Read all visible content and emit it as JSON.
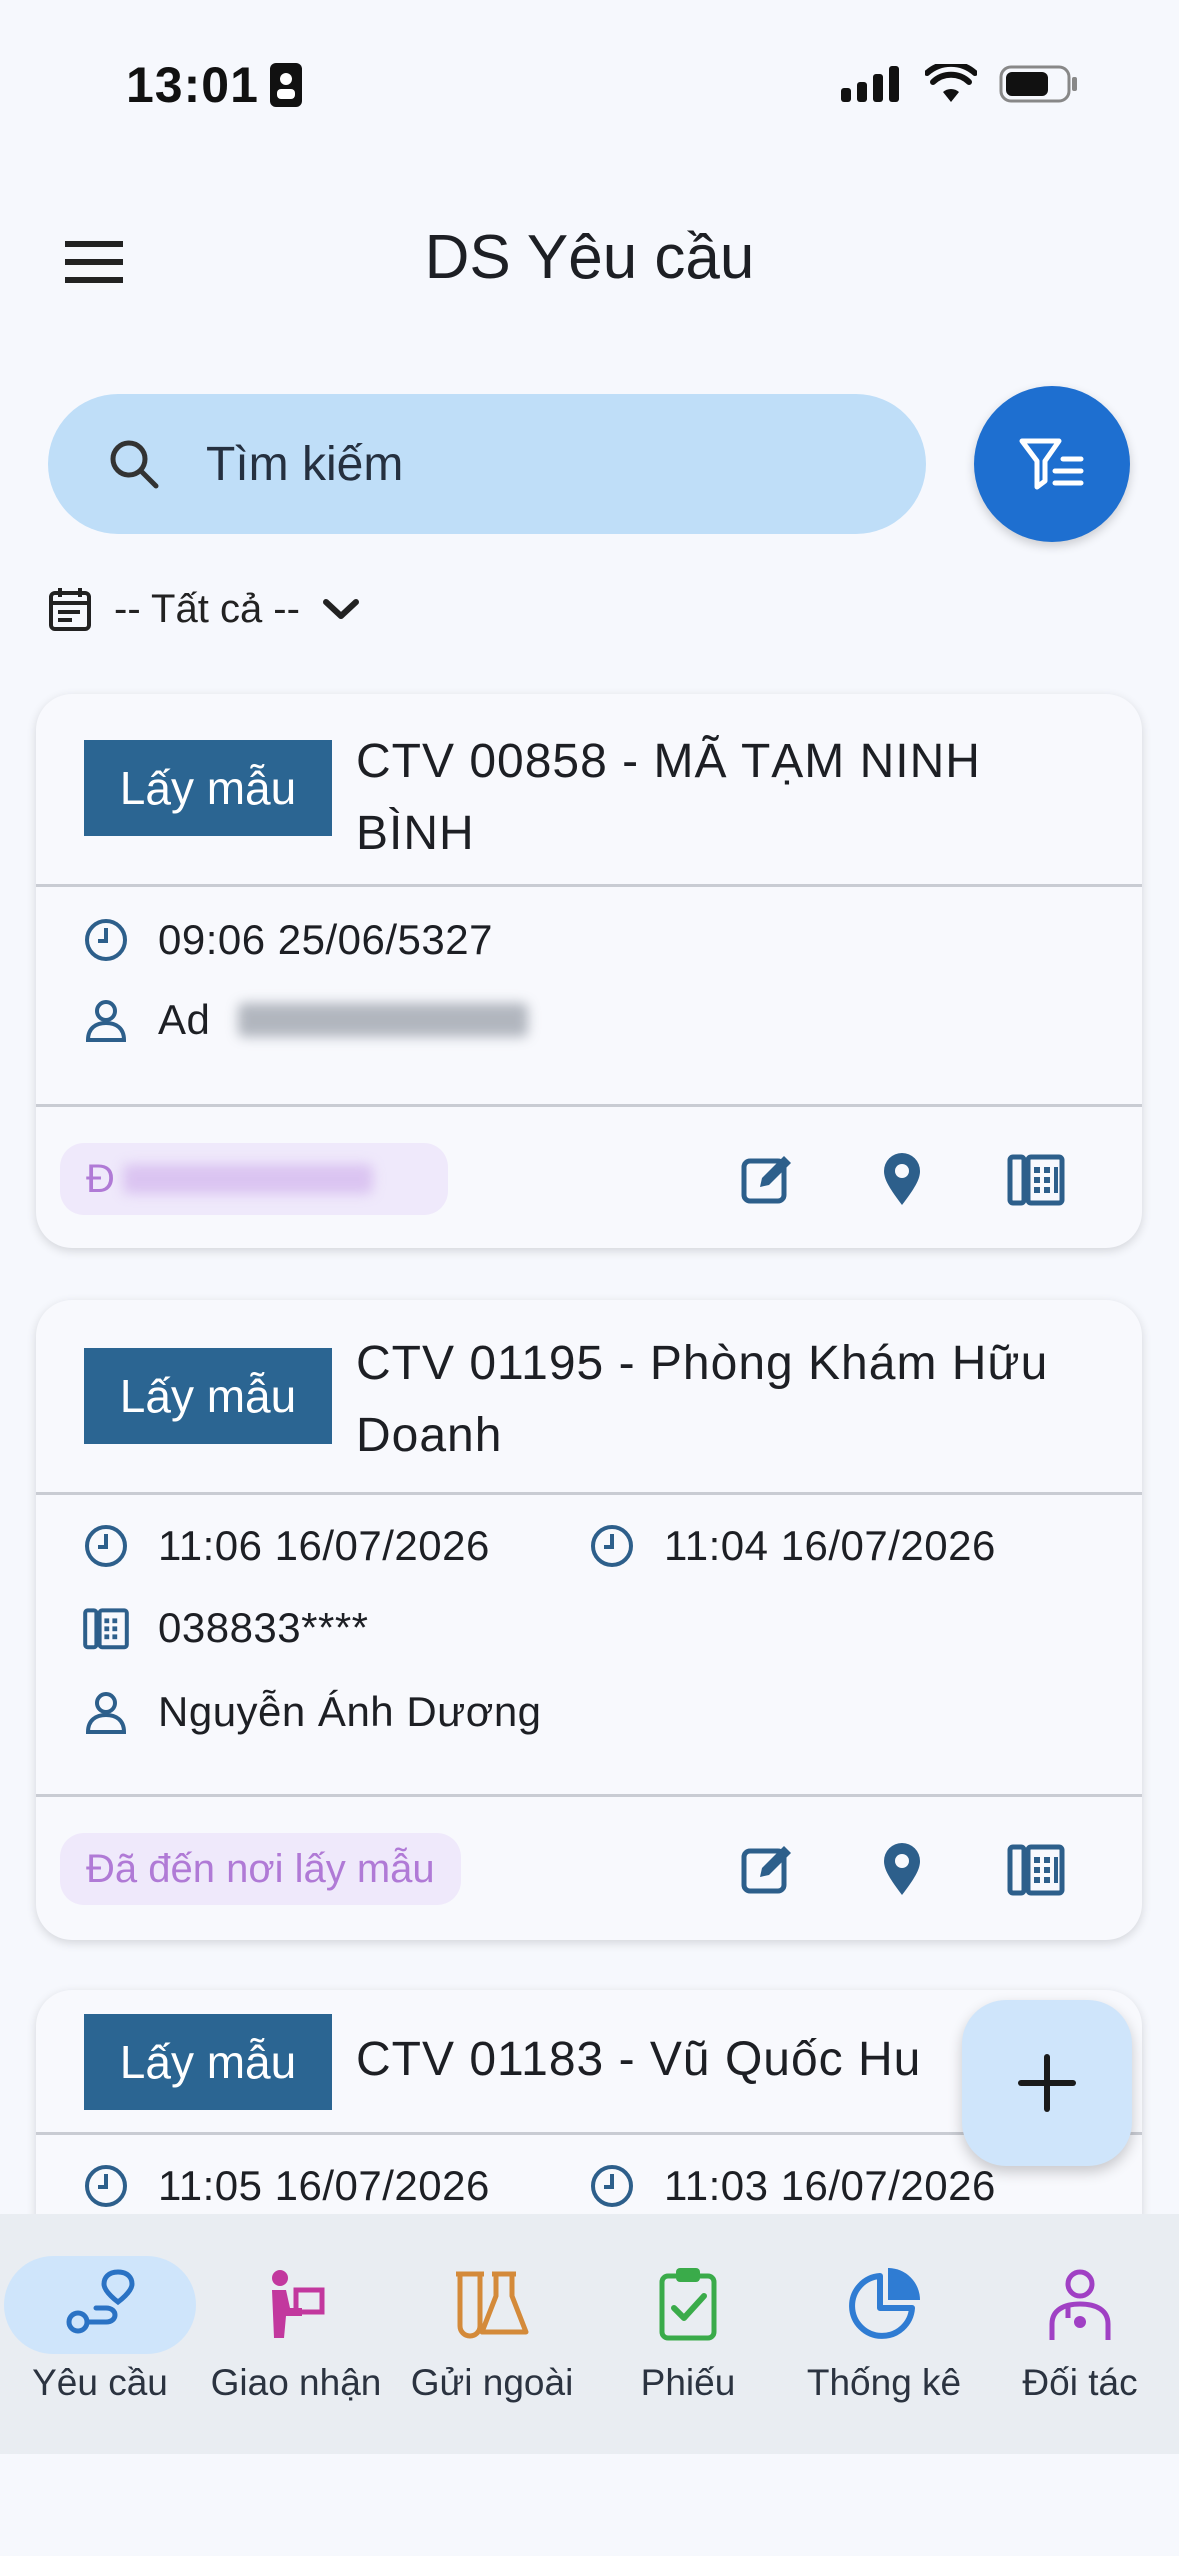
{
  "status_bar": {
    "time": "13:01"
  },
  "app_bar": {
    "title": "DS Yêu cầu"
  },
  "search": {
    "placeholder": "Tìm kiếm"
  },
  "date_filter": {
    "label": "-- Tất cả --"
  },
  "cards": [
    {
      "badge": "Lấy mẫu",
      "title": "CTV 00858 - MÃ TẠM NINH BÌNH",
      "time1": "09:06 25/06/5327",
      "person": "Ad",
      "status": "Đ"
    },
    {
      "badge": "Lấy mẫu",
      "title": "CTV 01195 - Phòng Khám Hữu Doanh",
      "time1": "11:06 16/07/2026",
      "time2": "11:04 16/07/2026",
      "phone": "038833****",
      "person": "Nguyễn Ánh Dương",
      "status": "Đã đến nơi lấy mẫu"
    },
    {
      "badge": "Lấy mẫu",
      "title": "CTV 01183 - Vũ Quốc Hu",
      "time1": "11:05 16/07/2026",
      "time2": "11:03 16/07/2026"
    }
  ],
  "bottom_nav": [
    {
      "label": "Yêu cầu",
      "color": "#2a72c4",
      "active": true
    },
    {
      "label": "Giao nhận",
      "color": "#c2389e"
    },
    {
      "label": "Gửi ngoài",
      "color": "#d48a3a"
    },
    {
      "label": "Phiếu",
      "color": "#3aab4a"
    },
    {
      "label": "Thống kê",
      "color": "#2f7cd3"
    },
    {
      "label": "Đối tác",
      "color": "#a040c4"
    }
  ],
  "colors": {
    "accent": "#1e6fd0",
    "badge": "#2b6592",
    "icon": "#2d5f8b",
    "status_text": "#b07ad6"
  }
}
